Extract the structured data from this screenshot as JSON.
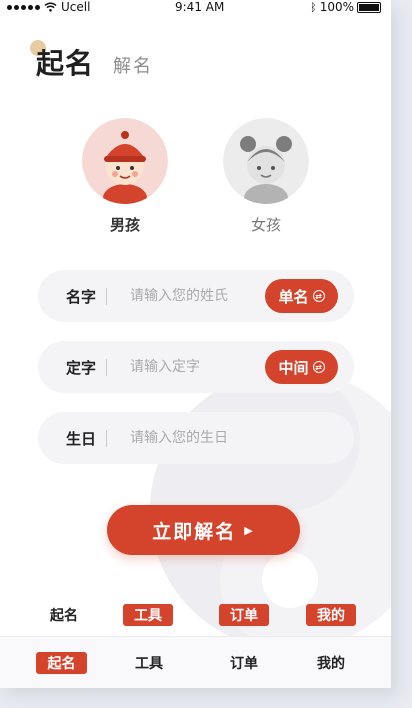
{
  "status_bar": {
    "carrier": "Ucell",
    "time": "9:41 AM",
    "battery": "100%"
  },
  "header": {
    "title": "起名",
    "subtitle": "解名"
  },
  "gender": [
    {
      "label": "男孩",
      "selected": true
    },
    {
      "label": "女孩",
      "selected": false
    }
  ],
  "form": {
    "name_row": {
      "label": "名字",
      "placeholder": "请输入您的姓氏",
      "toggle": "单名"
    },
    "fixed_row": {
      "label": "定字",
      "placeholder": "请输入定字",
      "toggle": "中间"
    },
    "birthday_row": {
      "label": "生日",
      "placeholder": "请输入您的生日"
    }
  },
  "submit": {
    "label": "立即解名"
  },
  "variant_row": [
    "起名",
    "工具",
    "订单",
    "我的"
  ],
  "tabbar": [
    {
      "label": "起名",
      "active": true
    },
    {
      "label": "工具",
      "active": false
    },
    {
      "label": "订单",
      "active": false
    },
    {
      "label": "我的",
      "active": false
    }
  ],
  "colors": {
    "accent": "#d4432c",
    "field_bg": "#f4f4f7",
    "page_bg": "#e9ebf1"
  }
}
